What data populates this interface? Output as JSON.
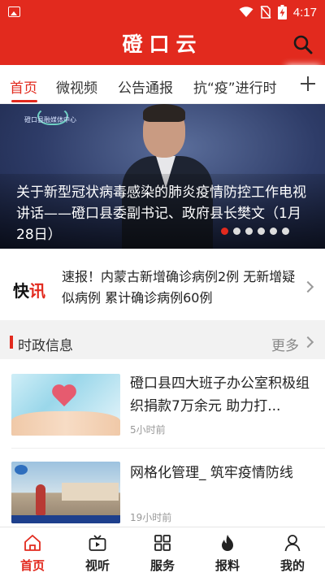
{
  "status_bar": {
    "time": "4:17"
  },
  "app": {
    "title": "磴口云"
  },
  "tabs": [
    {
      "label": "首页",
      "active": true
    },
    {
      "label": "微视频",
      "active": false
    },
    {
      "label": "公告通报",
      "active": false
    },
    {
      "label": "抗“疫”进行时",
      "active": false
    }
  ],
  "banner": {
    "station": "磴口县融媒体中心",
    "caption": "关于新型冠状病毒感染的肺炎疫情防控工作电视讲话——磴口县委副书记、政府县长樊文（1月28日）",
    "slide_count": 6,
    "active_slide": 1
  },
  "flash": {
    "logo": "快讯",
    "text": "速报！内蒙古新增确诊病例2例 无新增疑似病例 累计确诊病例60例"
  },
  "section": {
    "title": "时政信息",
    "more": "更多"
  },
  "news": [
    {
      "title": "磴口县四大班子办公室积极组织捐款7万余元 助力打...",
      "time": "5小时前"
    },
    {
      "title": "网格化管理_ 筑牢疫情防线",
      "time": "19小时前"
    }
  ],
  "nav": [
    {
      "label": "首页",
      "icon": "home-icon",
      "active": true
    },
    {
      "label": "视听",
      "icon": "tv-icon",
      "active": false
    },
    {
      "label": "服务",
      "icon": "grid-icon",
      "active": false
    },
    {
      "label": "报料",
      "icon": "flame-icon",
      "active": false
    },
    {
      "label": "我的",
      "icon": "person-icon",
      "active": false
    }
  ],
  "colors": {
    "brand": "#e22a1e",
    "active_dot": "#e22a1e"
  }
}
